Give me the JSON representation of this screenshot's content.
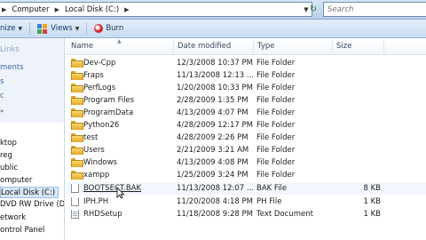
{
  "address": {
    "segments": [
      "Computer",
      "Local Disk (C:)"
    ],
    "search_placeholder": "Search"
  },
  "toolbar": {
    "organize_label": "nize",
    "views_label": "Views",
    "burn_label": "Burn"
  },
  "nav": {
    "links_label": "Links",
    "items_top": [
      "ments",
      "s",
      "c"
    ],
    "items": [
      "ktop",
      "reg",
      "ublic",
      "omputer",
      "Local Disk (C:)",
      "DVD RW Drive (D:)",
      "etwork",
      "ontrol Panel"
    ]
  },
  "columns": {
    "name": "Name",
    "date": "Date modified",
    "type": "Type",
    "size": "Size"
  },
  "files": [
    {
      "name": "Dev-Cpp",
      "date": "12/3/2008 10:37 PM",
      "type": "File Folder",
      "size": "",
      "icon": "folder-icon"
    },
    {
      "name": "Fraps",
      "date": "11/13/2008 12:13 ...",
      "type": "File Folder",
      "size": "",
      "icon": "folder-icon"
    },
    {
      "name": "PerfLogs",
      "date": "1/20/2008 10:33 PM",
      "type": "File Folder",
      "size": "",
      "icon": "folder-icon"
    },
    {
      "name": "Program Files",
      "date": "2/28/2009 1:35 PM",
      "type": "File Folder",
      "size": "",
      "icon": "folder-icon"
    },
    {
      "name": "ProgramData",
      "date": "4/13/2009 4:07 PM",
      "type": "File Folder",
      "size": "",
      "icon": "folder-icon"
    },
    {
      "name": "Python26",
      "date": "4/28/2009 12:17 PM",
      "type": "File Folder",
      "size": "",
      "icon": "folder-icon"
    },
    {
      "name": "test",
      "date": "4/28/2009 2:26 PM",
      "type": "File Folder",
      "size": "",
      "icon": "folder-icon"
    },
    {
      "name": "Users",
      "date": "2/21/2009 3:21 AM",
      "type": "File Folder",
      "size": "",
      "icon": "folder-icon"
    },
    {
      "name": "Windows",
      "date": "4/13/2009 4:08 PM",
      "type": "File Folder",
      "size": "",
      "icon": "folder-icon"
    },
    {
      "name": "xampp",
      "date": "1/25/2009 3:24 PM",
      "type": "File Folder",
      "size": "",
      "icon": "folder-icon"
    },
    {
      "name": "BOOTSECT.BAK",
      "date": "11/13/2008 12:07 ...",
      "type": "BAK File",
      "size": "8 KB",
      "icon": "file-icon"
    },
    {
      "name": "IPH.PH",
      "date": "11/20/2008 4:18 PM",
      "type": "PH File",
      "size": "1 KB",
      "icon": "file-icon"
    },
    {
      "name": "RHDSetup",
      "date": "11/18/2008 9:28 PM",
      "type": "Text Document",
      "size": "1 KB",
      "icon": "text-file-icon"
    }
  ]
}
